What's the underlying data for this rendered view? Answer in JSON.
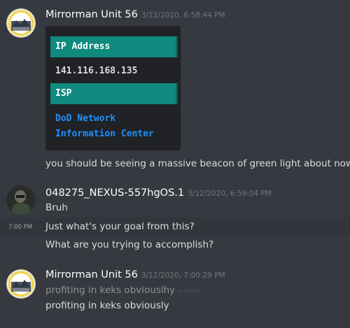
{
  "messages": [
    {
      "author": "Mirrorman Unit 56",
      "timestamp": "3/12/2020, 6:58:44 PM",
      "embed": {
        "field1_name": "IP Address",
        "field1_value": "141.116.168.135",
        "field2_name": "ISP",
        "field2_value_line1": "DoD Network",
        "field2_value_line2": "Information Center"
      },
      "text": "you should be seeing a massive beacon of green light about now"
    },
    {
      "author": "048275_NEXUS-557hgOS.1",
      "timestamp": "3/12/2020, 6:59:04 PM",
      "text": "Bruh",
      "followups": [
        {
          "time": "7:00 PM",
          "text": "Just what's your goal from this?"
        },
        {
          "text": "What are you trying to accomplish?"
        }
      ]
    },
    {
      "author": "Mirrorman Unit 56",
      "timestamp": "3/12/2020, 7:00:29 PM",
      "old_text": "profiting in keks obviouslhy",
      "edited_label": "(edited)",
      "text": "profiting in keks obviously"
    }
  ],
  "colors": {
    "background": "#36393f",
    "embed_header": "#0f8a7e",
    "link": "#1e90ff"
  }
}
